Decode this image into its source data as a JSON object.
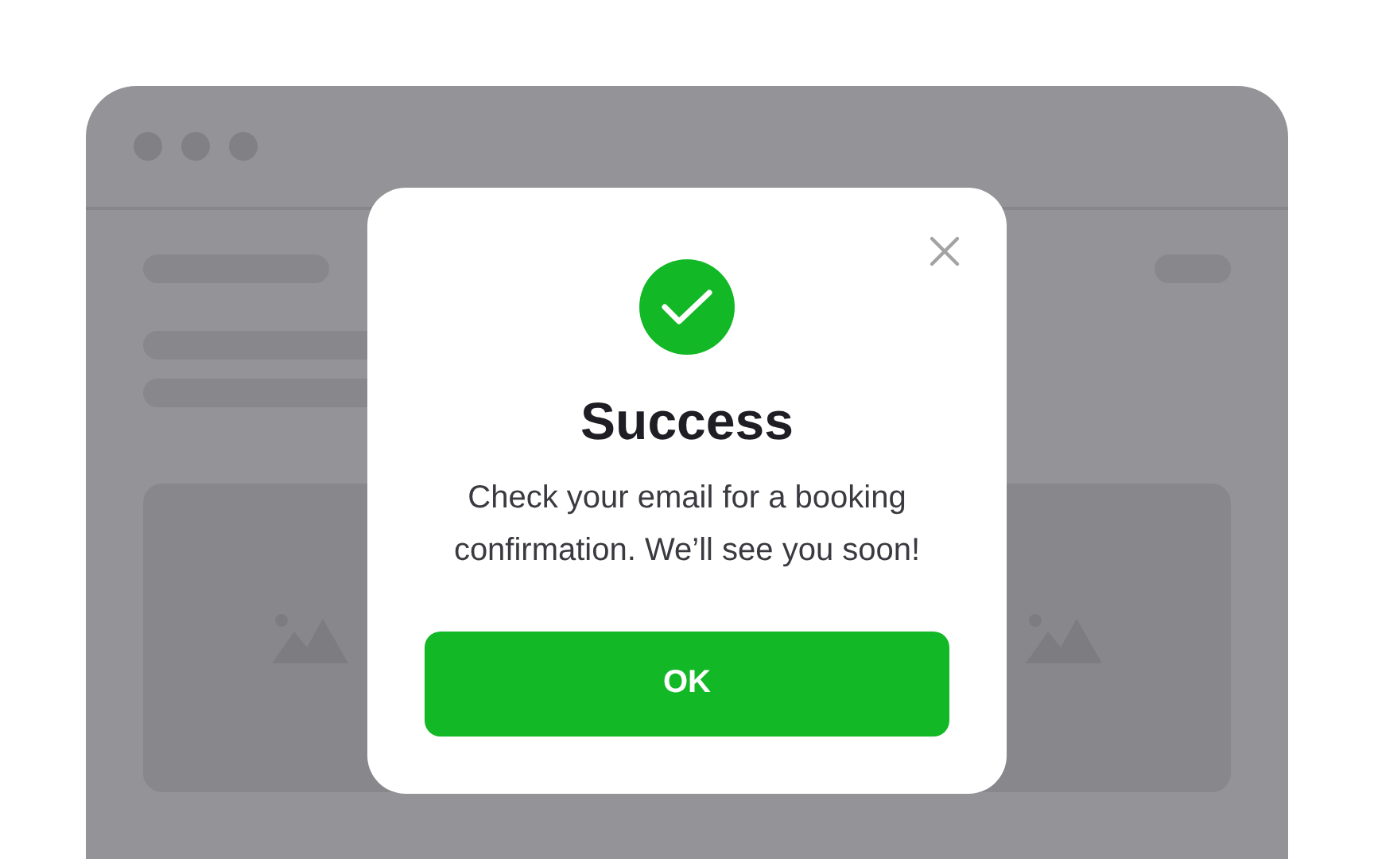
{
  "dialog": {
    "title": "Success",
    "message": "Check your email for a booking confirmation. We’ll see you soon!",
    "button": "OK"
  }
}
